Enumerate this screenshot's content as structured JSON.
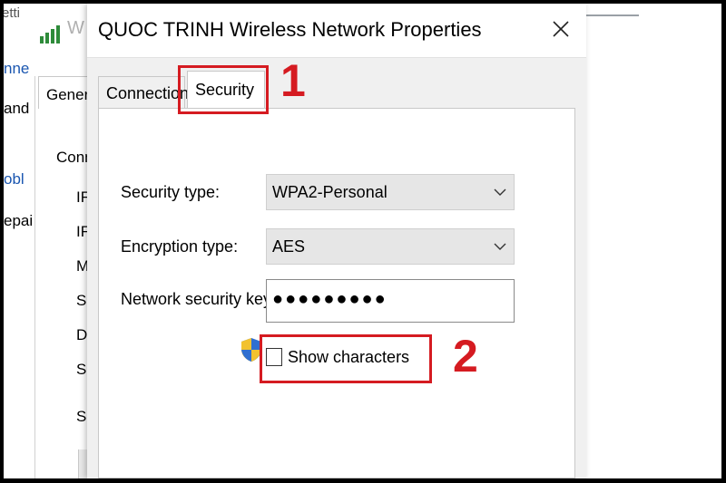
{
  "background": {
    "title_fragment": "W",
    "top_right_fragment": "etti",
    "left_fragments": [
      "nne",
      "and",
      "obl",
      "epai"
    ],
    "general_tab": "Gener",
    "connection_fragment": "Conn",
    "field_fragments": [
      "IF",
      "IF",
      "M",
      "S",
      "D",
      "S",
      "S"
    ]
  },
  "dialog": {
    "title": "QUOC TRINH Wireless Network Properties",
    "tabs": [
      {
        "label": "Connection",
        "selected": false
      },
      {
        "label": "Security",
        "selected": true
      }
    ],
    "security_type_label": "Security type:",
    "security_type_value": "WPA2-Personal",
    "encryption_type_label": "Encryption type:",
    "encryption_type_value": "AES",
    "network_key_label": "Network security key",
    "network_key_value": "●●●●●●●●●",
    "show_characters_label": "Show characters",
    "show_characters_checked": false
  },
  "annotations": {
    "step1": "1",
    "step2": "2",
    "color": "#d51b21"
  },
  "icons": [
    "signal-icon",
    "close-icon",
    "chevron-down-icon",
    "shield-icon"
  ]
}
